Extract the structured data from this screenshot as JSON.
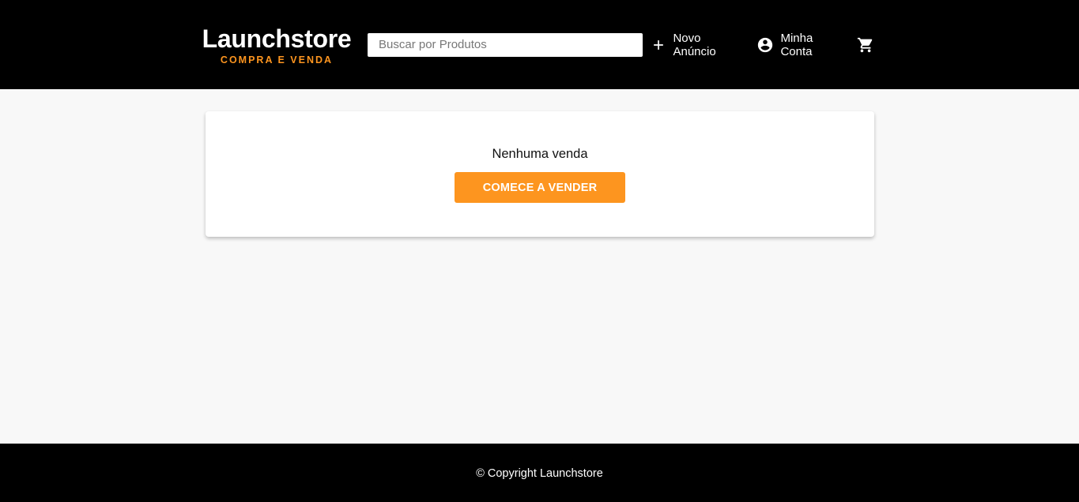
{
  "header": {
    "logo_title": "Launchstore",
    "logo_subtitle": "COMPRA E VENDA",
    "search_placeholder": "Buscar por Produtos",
    "new_ad_label": "Novo Anúncio",
    "account_label": "Minha Conta",
    "icons": {
      "new_ad": "plus-icon",
      "account": "account-circle-icon",
      "cart": "shopping-cart-icon"
    }
  },
  "main": {
    "empty_message": "Nenhuma venda",
    "cta_label": "COMECE A VENDER"
  },
  "footer": {
    "copyright": "© Copyright Launchstore"
  },
  "colors": {
    "accent": "#fd951f",
    "header_bg": "#000000",
    "page_bg": "#f8f8f8",
    "card_bg": "#ffffff"
  }
}
